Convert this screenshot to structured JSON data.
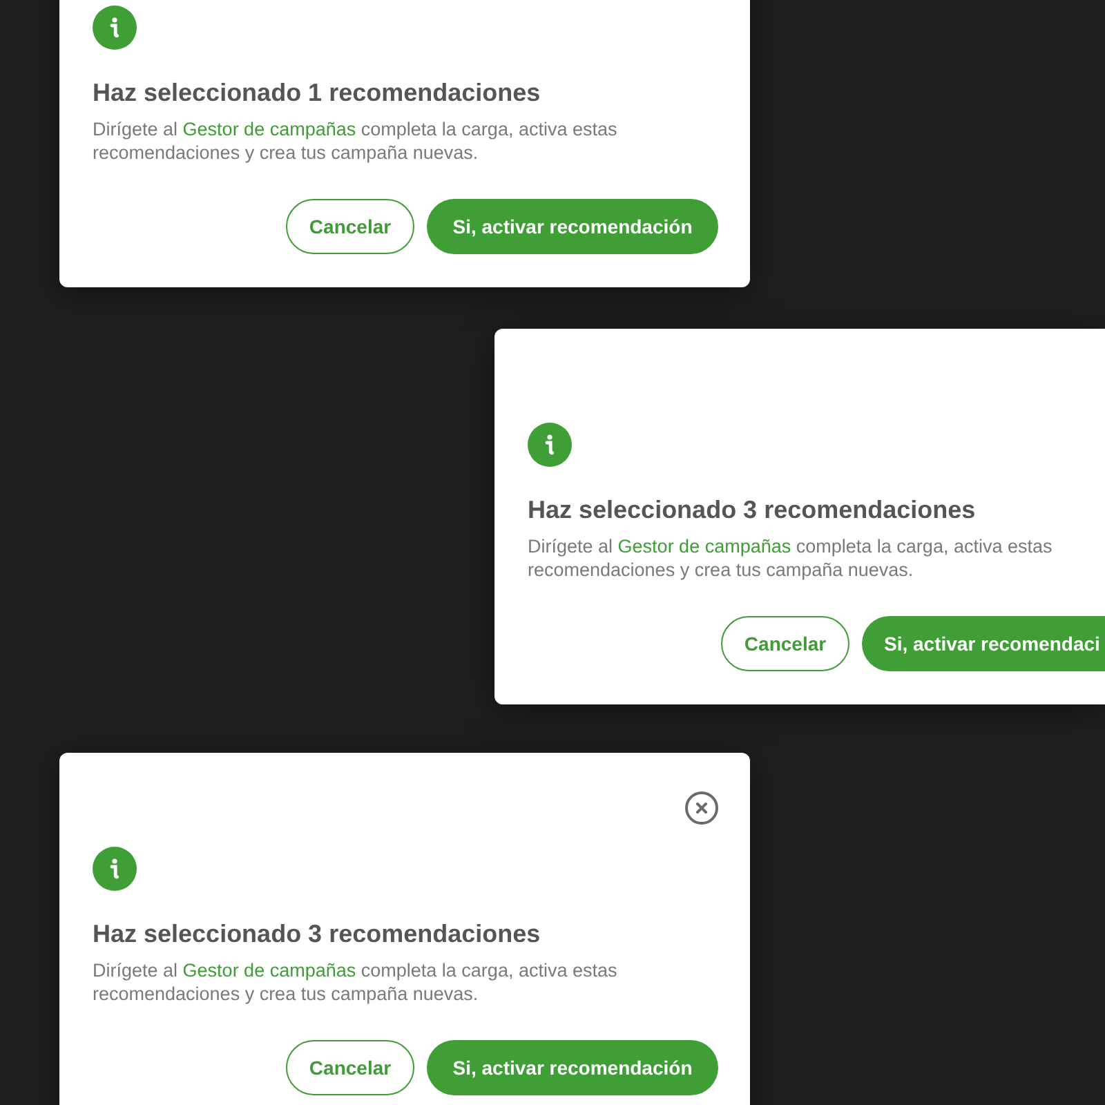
{
  "dialogs": [
    {
      "close_button": false,
      "title": "Haz seleccionado 1 recomendaciones",
      "message": {
        "before": "Dirígete al",
        "link": "Gestor de campañas",
        "after": "completa la carga, activa estas recomendaciones y crea tus campaña nuevas."
      },
      "buttons": [
        {
          "kind": "secondary",
          "label": "Cancelar"
        },
        {
          "kind": "primary",
          "label": "Si, activar recomendación"
        }
      ]
    },
    {
      "close_button": false,
      "title": "Haz seleccionado 3 recomendaciones",
      "message": {
        "before": "Dirígete al",
        "link": "Gestor de campañas",
        "after": "completa la carga, activa estas recomendaciones y crea tus campaña nuevas."
      },
      "buttons": [
        {
          "kind": "secondary",
          "label": "Cancelar"
        },
        {
          "kind": "primary",
          "label": "Si, activar recomendaci"
        }
      ]
    },
    {
      "close_button": true,
      "title": "Haz seleccionado 3 recomendaciones",
      "message": {
        "before": "Dirígete al",
        "link": "Gestor de campañas",
        "after": "completa la carga, activa estas recomendaciones y crea tus campaña nuevas."
      },
      "buttons": [
        {
          "kind": "secondary",
          "label": "Cancelar"
        },
        {
          "kind": "primary",
          "label": "Si, activar recomendación"
        }
      ]
    }
  ]
}
